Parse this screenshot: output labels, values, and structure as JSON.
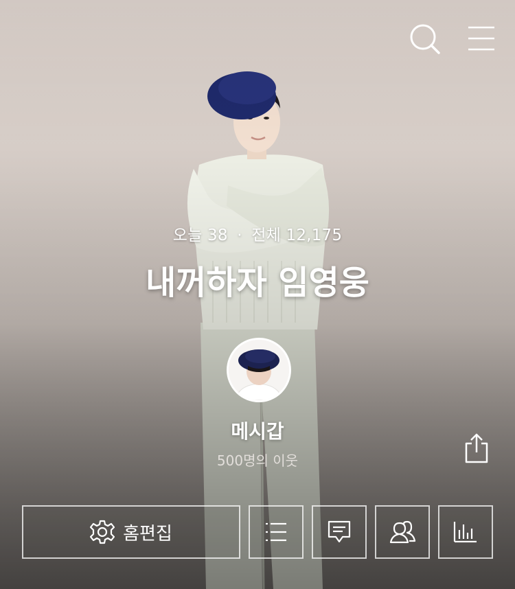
{
  "header": {
    "icons": [
      "search-icon",
      "menu-icon"
    ]
  },
  "profile": {
    "visit_today_label": "오늘",
    "visit_today_count": "38",
    "visit_separator": "·",
    "visit_total_label": "전체",
    "visit_total_count": "12,175",
    "blog_title": "내꺼하자 임영웅",
    "nickname": "메시갑",
    "neighbors": "500명의 이웃"
  },
  "actions": {
    "home_edit_label": "홈편집",
    "icons": [
      "gear-icon",
      "list-icon",
      "comment-icon",
      "neighbor-icon",
      "stats-icon",
      "share-icon"
    ]
  },
  "colors": {
    "text": "#ffffff",
    "subtext": "#e2deda",
    "button_border": "rgba(255,255,255,0.75)"
  }
}
